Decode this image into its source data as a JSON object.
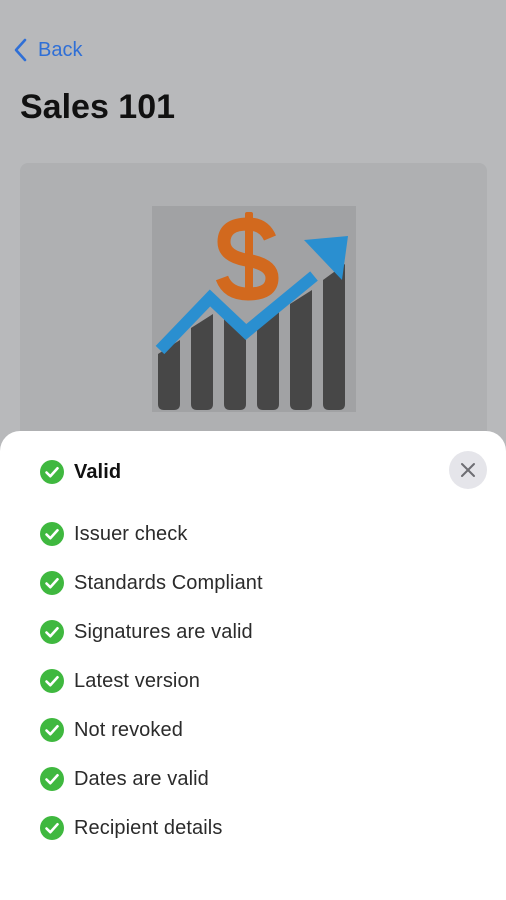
{
  "nav": {
    "back_label": "Back"
  },
  "page": {
    "title": "Sales 101"
  },
  "sheet": {
    "status_label": "Valid",
    "checks": [
      "Issuer check",
      "Standards Compliant",
      "Signatures are valid",
      "Latest version",
      "Not revoked",
      "Dates are valid",
      "Recipient details"
    ]
  },
  "colors": {
    "accent": "#2f6fd6",
    "success": "#3fb83f",
    "logo_dollar": "#d2691e",
    "logo_arrow": "#2a8fd0",
    "logo_bars": "#474747"
  },
  "icons": {
    "back": "chevron-left-icon",
    "close": "close-icon",
    "check": "check-circle-icon"
  }
}
